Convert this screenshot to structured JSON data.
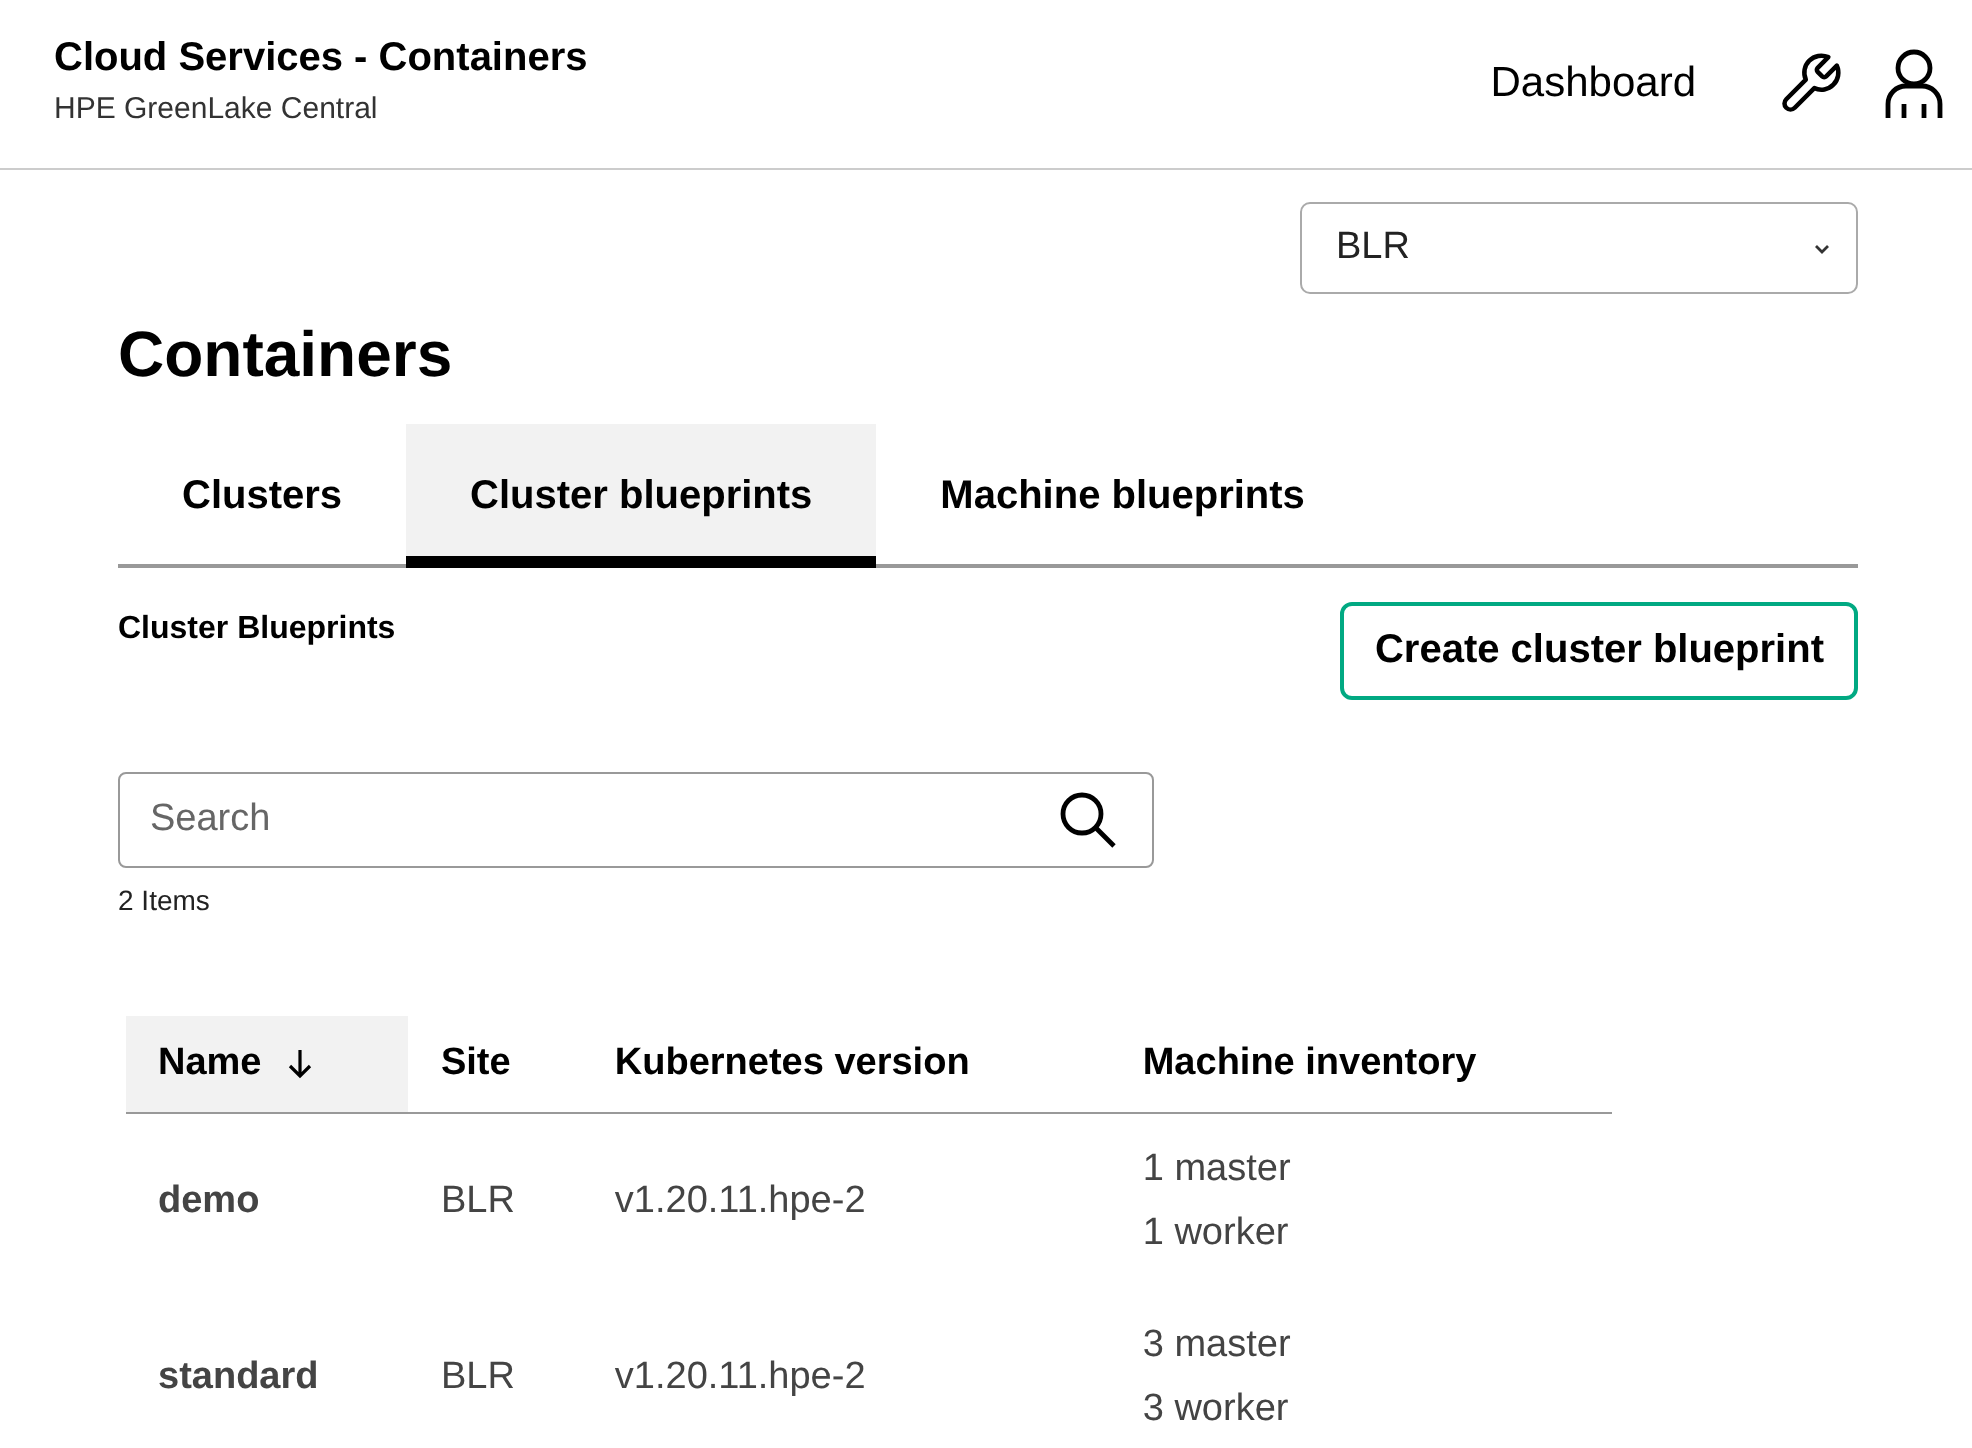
{
  "header": {
    "title": "Cloud Services - Containers",
    "subtitle": "HPE GreenLake Central",
    "nav_link": "Dashboard"
  },
  "site_select": {
    "value": "BLR"
  },
  "page_title": "Containers",
  "tabs": [
    {
      "label": "Clusters",
      "selected": false
    },
    {
      "label": "Cluster blueprints",
      "selected": true
    },
    {
      "label": "Machine blueprints",
      "selected": false
    }
  ],
  "section_title": "Cluster Blueprints",
  "create_button": "Create cluster blueprint",
  "search": {
    "placeholder": "Search"
  },
  "item_count": "2 Items",
  "table": {
    "columns": [
      {
        "label": "Name",
        "sorted": true
      },
      {
        "label": "Site",
        "sorted": false
      },
      {
        "label": "Kubernetes version",
        "sorted": false
      },
      {
        "label": "Machine inventory",
        "sorted": false
      }
    ],
    "rows": [
      {
        "name": "demo",
        "site": "BLR",
        "version": "v1.20.11.hpe-2",
        "inventory": [
          "1 master",
          "1 worker"
        ]
      },
      {
        "name": "standard",
        "site": "BLR",
        "version": "v1.20.11.hpe-2",
        "inventory": [
          "3 master",
          "3 worker"
        ]
      }
    ]
  }
}
